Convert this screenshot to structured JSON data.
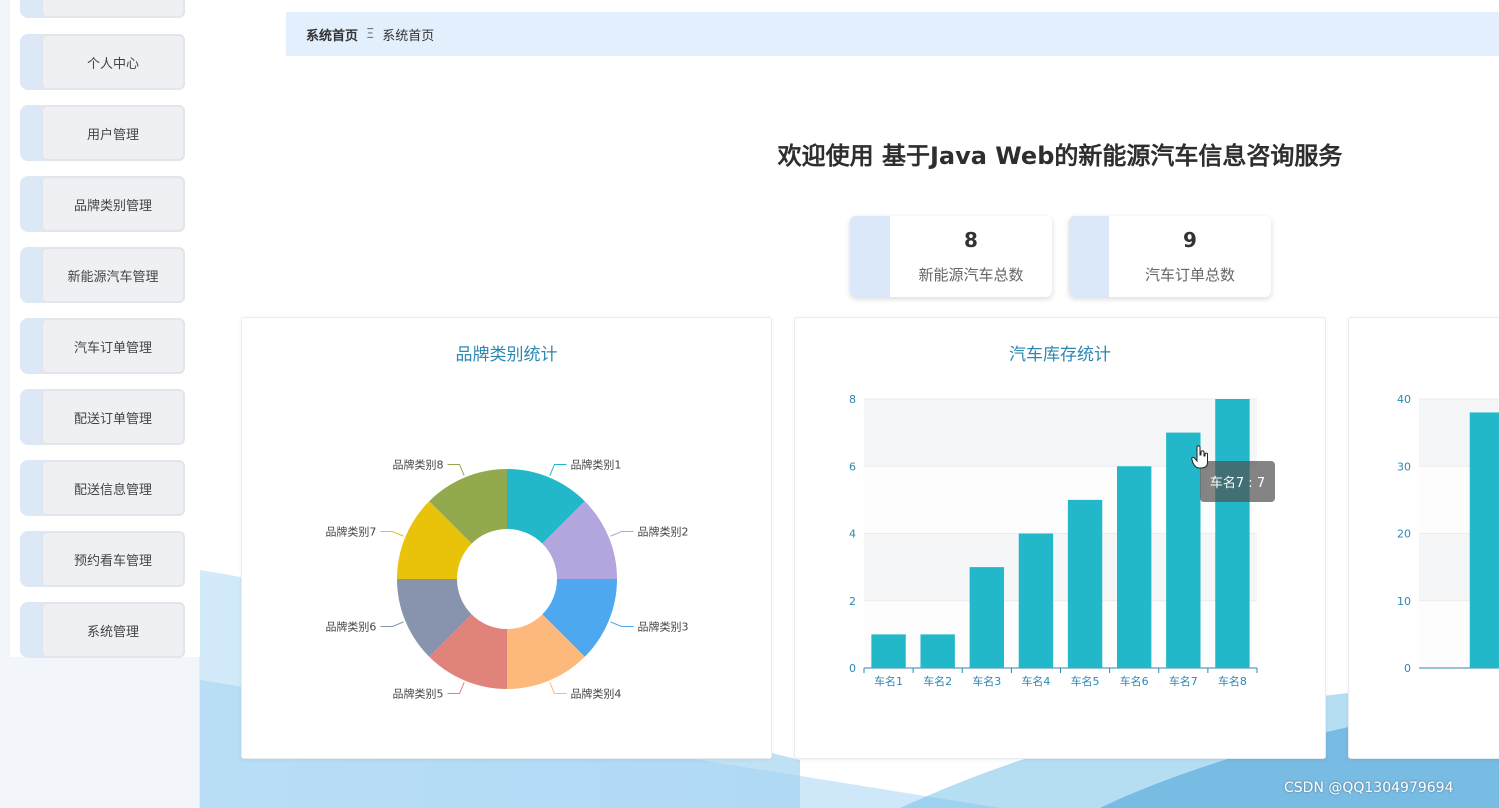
{
  "sidebar": {
    "items": [
      {
        "label": ""
      },
      {
        "label": "个人中心"
      },
      {
        "label": "用户管理"
      },
      {
        "label": "品牌类别管理"
      },
      {
        "label": "新能源汽车管理"
      },
      {
        "label": "汽车订单管理"
      },
      {
        "label": "配送订单管理"
      },
      {
        "label": "配送信息管理"
      },
      {
        "label": "预约看车管理"
      },
      {
        "label": "系统管理"
      }
    ]
  },
  "breadcrumb": {
    "home": "系统首页",
    "separator": "Ξ",
    "current": "系统首页"
  },
  "page_title": "欢迎使用 基于Java Web的新能源汽车信息咨询服务",
  "stats": [
    {
      "value": "8",
      "label": "新能源汽车总数"
    },
    {
      "value": "9",
      "label": "汽车订单总数"
    }
  ],
  "chart_data": [
    {
      "type": "pie",
      "title": "品牌类别统计",
      "categories": [
        "品牌类别1",
        "品牌类别2",
        "品牌类别3",
        "品牌类别4",
        "品牌类别5",
        "品牌类别6",
        "品牌类别7",
        "品牌类别8"
      ],
      "values": [
        1,
        1,
        1,
        1,
        1,
        1,
        1,
        1
      ],
      "colors": [
        "#22b8c9",
        "#b3a6de",
        "#4ea8ef",
        "#fdb97c",
        "#e0847b",
        "#8893ad",
        "#e8c30a",
        "#93a94e"
      ],
      "donut": true
    },
    {
      "type": "bar",
      "title": "汽车库存统计",
      "categories": [
        "车名1",
        "车名2",
        "车名3",
        "车名4",
        "车名5",
        "车名6",
        "车名7",
        "车名8"
      ],
      "values": [
        1,
        1,
        3,
        4,
        5,
        6,
        7,
        8
      ],
      "ylim": [
        0,
        8
      ],
      "yticks": [
        0,
        2,
        4,
        6,
        8
      ],
      "color": "#22b8c9",
      "tooltip": "车名7 : 7"
    },
    {
      "type": "bar",
      "title": "",
      "categories": [],
      "values": [
        38
      ],
      "ylim": [
        0,
        40
      ],
      "yticks": [
        0,
        10,
        20,
        30,
        40
      ],
      "color": "#22b8c9"
    }
  ],
  "watermark": "CSDN @QQ1304979694",
  "colors": {
    "accent": "#22b8c9",
    "title": "#2b88b3",
    "breadcrumb_bg": "#e3effd"
  }
}
